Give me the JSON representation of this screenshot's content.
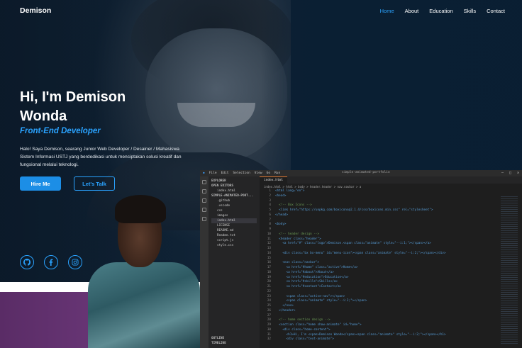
{
  "nav": {
    "logo": "Demison",
    "links": [
      "Home",
      "About",
      "Education",
      "Skills",
      "Contact"
    ],
    "active_index": 0
  },
  "hero": {
    "title_line1": "Hi, I'm Demison",
    "title_line2": "Wonda",
    "subtitle": "Front-End Developer",
    "description": "Halo! Saya Demison, searang Junior Web Developer / Desainer / Mahasiswa Sistem Informasi USTJ yang berdedikasi untuk menciptakan solusi kreatif dan fungsional melalui teknologi.",
    "hire_button": "Hire Me",
    "talk_button": "Let's Talk"
  },
  "social": [
    "github-icon",
    "facebook-icon",
    "instagram-icon"
  ],
  "colors": {
    "accent": "#2aa3ff",
    "button": "#1c8ee6",
    "background": "#0b1a2a",
    "purple": "#6a3778"
  },
  "vscode": {
    "menu": [
      "File",
      "Edit",
      "Selection",
      "View",
      "Go",
      "Run"
    ],
    "window_title": "simple-animated-portfolio",
    "explorer_title": "EXPLORER",
    "open_editors": "OPEN EDITORS",
    "open_file": "index.html",
    "project": "SIMPLE-ANIMATED-PORT...",
    "files": [
      ".github",
      ".vscode",
      "css",
      "images",
      "index.html",
      "LICENSE",
      "README.md",
      "Readme.txt",
      "script.js",
      "style.css"
    ],
    "outline": "OUTLINE",
    "timeline": "TIMELINE",
    "tab": "index.html",
    "breadcrumb": "index.html > html > body > header.header > nav.navbar > a",
    "code_lines": [
      {
        "n": "1",
        "code": "<html lang=\"en\">"
      },
      {
        "n": "2",
        "code": "<head>"
      },
      {
        "n": "3",
        "code": ""
      },
      {
        "n": "4",
        "code": "  <!-- Box Icons -->"
      },
      {
        "n": "5",
        "code": "  <link href=\"https://unpkg.com/boxicons@2.1.4/css/boxicons.min.css\" rel=\"stylesheet\">"
      },
      {
        "n": "6",
        "code": "</head>"
      },
      {
        "n": "7",
        "code": ""
      },
      {
        "n": "8",
        "code": "<body>"
      },
      {
        "n": "9",
        "code": ""
      },
      {
        "n": "10",
        "code": "  <!-- header design -->"
      },
      {
        "n": "11",
        "code": "  <header class=\"header\">"
      },
      {
        "n": "12",
        "code": "    <a href=\"#\" class=\"logo\">Demison.<span class=\"animate\" style=\"--i:1;\"></span></a>"
      },
      {
        "n": "13",
        "code": ""
      },
      {
        "n": "14",
        "code": "    <div class=\"bx bx-menu\" id=\"menu-icon\"><span class=\"animate\" style=\"--i:2;\"></span></div>"
      },
      {
        "n": "15",
        "code": ""
      },
      {
        "n": "16",
        "code": "    <nav class=\"navbar\">"
      },
      {
        "n": "17",
        "code": "      <a href=\"#home\" class=\"active\">Home</a>"
      },
      {
        "n": "18",
        "code": "      <a href=\"#about\">About</a>"
      },
      {
        "n": "19",
        "code": "      <a href=\"#education\">Education</a>"
      },
      {
        "n": "20",
        "code": "      <a href=\"#skills\">Skills</a>"
      },
      {
        "n": "21",
        "code": "      <a href=\"#contact\">Contact</a>"
      },
      {
        "n": "22",
        "code": ""
      },
      {
        "n": "23",
        "code": "      <span class=\"active-nav\"></span>"
      },
      {
        "n": "24",
        "code": "      <span class=\"animate\" style=\"--i:2;\"></span>"
      },
      {
        "n": "25",
        "code": "    </nav>"
      },
      {
        "n": "26",
        "code": "  </header>"
      },
      {
        "n": "27",
        "code": ""
      },
      {
        "n": "28",
        "code": "  <!-- home section design -->"
      },
      {
        "n": "29",
        "code": "  <section class=\"home show-animate\" id=\"home\">"
      },
      {
        "n": "30",
        "code": "    <div class=\"home-content\">"
      },
      {
        "n": "31",
        "code": "      <h1>Hi, I'm <span>Demison Wonda</span><span class=\"animate\" style=\"--i:2;\"></span></h1>"
      },
      {
        "n": "32",
        "code": "      <div class=\"text-animate\">"
      }
    ]
  }
}
